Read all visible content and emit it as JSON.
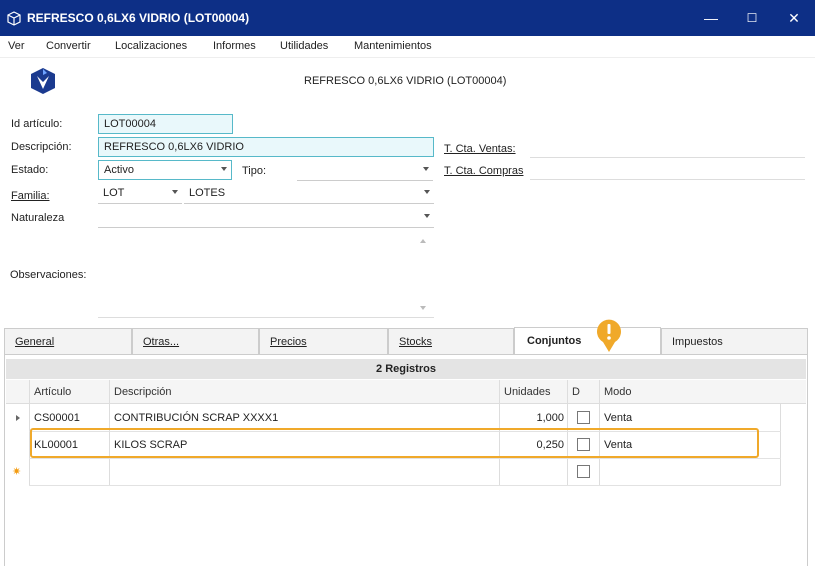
{
  "window": {
    "title": "REFRESCO 0,6LX6 VIDRIO (LOT00004)",
    "controls": {
      "minimize": "—",
      "maximize": "☐",
      "close": "✕"
    }
  },
  "menu": [
    "Ver",
    "Convertir",
    "Localizaciones",
    "Informes",
    "Utilidades",
    "Mantenimientos"
  ],
  "header": {
    "title": "REFRESCO 0,6LX6 VIDRIO (LOT00004)"
  },
  "form": {
    "id_label": "Id artículo:",
    "id_value": "LOT00004",
    "desc_label": "Descripción:",
    "desc_value": "REFRESCO 0,6LX6 VIDRIO",
    "estado_label": "Estado:",
    "estado_value": "Activo",
    "tipo_label": "Tipo:",
    "tipo_value": "",
    "familia_label": "Familia:",
    "familia_code": "LOT",
    "familia_name": "LOTES",
    "naturaleza_label": "Naturaleza",
    "naturaleza_value": "",
    "observaciones_label": "Observaciones:",
    "cta_ventas_label": "T. Cta. Ventas:",
    "cta_compras_label": "T. Cta. Compras"
  },
  "tabs": [
    {
      "label": "General",
      "active": false
    },
    {
      "label": "Otras...",
      "active": false
    },
    {
      "label": "Precios",
      "active": false
    },
    {
      "label": "Stocks",
      "active": false
    },
    {
      "label": "Conjuntos",
      "active": true
    },
    {
      "label": "Impuestos",
      "active": false
    }
  ],
  "grid": {
    "record_count": "2 Registros",
    "columns": [
      "Artículo",
      "Descripción",
      "Unidades",
      "D",
      "Modo"
    ],
    "rows": [
      {
        "articulo": "CS00001",
        "descripcion": "CONTRIBUCIÓN SCRAP XXXX1",
        "unidades": "1,000",
        "d": false,
        "modo": "Venta"
      },
      {
        "articulo": "KL00001",
        "descripcion": "KILOS SCRAP",
        "unidades": "0,250",
        "d": false,
        "modo": "Venta"
      }
    ]
  },
  "colors": {
    "titlebar": "#0d2f86",
    "accent": "#f0a92a",
    "input_border": "#57b9c9"
  },
  "icons": [
    "box-icon",
    "app-logo-icon",
    "warning-marker-icon",
    "new-row-icon"
  ]
}
